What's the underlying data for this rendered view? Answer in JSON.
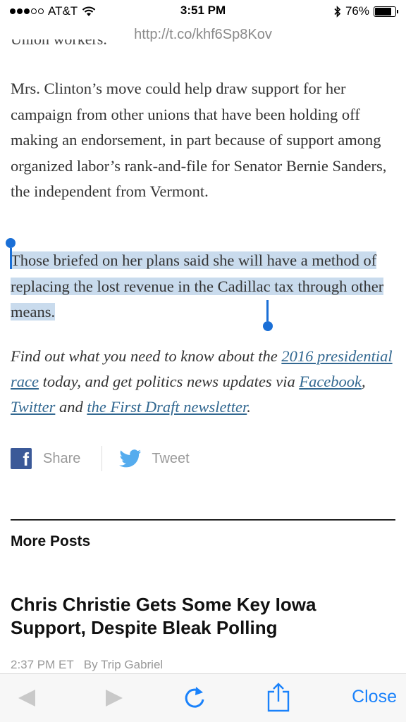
{
  "status_bar": {
    "carrier": "AT&T",
    "time": "3:51 PM",
    "battery_pct": "76%",
    "battery_level": 0.76
  },
  "url": "http://t.co/khf6Sp8Kov",
  "article": {
    "para1": "Mrs. Clinton’s move could help draw support for her campaign from other unions that have been holding off making an endorsement, in part because of support among organized labor’s rank-and-file for Senator Bernie Sanders, the independent from Vermont.",
    "para2_selected": "Those briefed on her plans said she will have a method of replacing the lost revenue in the Cadillac tax through other means.",
    "para3": {
      "t1": "Find out what you need to know about the ",
      "link1": "2016 presidential race",
      "t2": " today, and get politics news updates via ",
      "link2": "Facebook",
      "t3": ", ",
      "link3": "Twitter",
      "t4": " and ",
      "link4": "the First Draft newsletter",
      "t5": "."
    }
  },
  "share": {
    "facebook_label": "Share",
    "twitter_label": "Tweet"
  },
  "more_posts": {
    "heading": "More Posts",
    "post_title": "Chris Christie Gets Some Key Iowa Support, Despite Bleak Polling",
    "post_time": "2:37 PM ET",
    "post_byline": "By Trip Gabriel"
  },
  "toolbar": {
    "close_label": "Close"
  },
  "colors": {
    "link": "#326891",
    "selection": "#c9dbed",
    "handle": "#1a6fd6",
    "close": "#1a82fb",
    "facebook": "#3b5998",
    "twitter": "#55acee"
  }
}
